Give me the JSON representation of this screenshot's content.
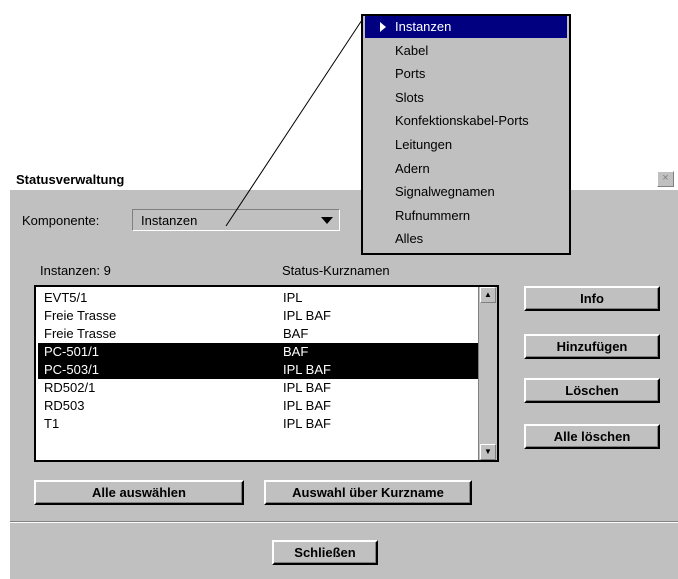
{
  "dialog": {
    "title": "Statusverwaltung",
    "close_label": "×",
    "komponente_label": "Komponente:",
    "combo_value": "Instanzen"
  },
  "list": {
    "header_left": "Instanzen: 9",
    "header_right": "Status-Kurznamen",
    "rows": [
      {
        "name": "EVT5/1",
        "status": "IPL",
        "selected": false
      },
      {
        "name": "Freie Trasse",
        "status": "IPL BAF",
        "selected": false
      },
      {
        "name": "Freie Trasse",
        "status": "BAF",
        "selected": false
      },
      {
        "name": "PC-501/1",
        "status": "BAF",
        "selected": true
      },
      {
        "name": "PC-503/1",
        "status": "IPL BAF",
        "selected": true
      },
      {
        "name": "RD502/1",
        "status": "IPL BAF",
        "selected": false
      },
      {
        "name": "RD503",
        "status": "IPL BAF",
        "selected": false
      },
      {
        "name": "T1",
        "status": "IPL BAF",
        "selected": false
      }
    ]
  },
  "buttons": {
    "info": "Info",
    "add": "Hinzufügen",
    "delete": "Löschen",
    "delete_all": "Alle löschen",
    "select_all": "Alle auswählen",
    "select_by_shortname": "Auswahl über Kurzname",
    "close": "Schließen"
  },
  "dropdown_menu": {
    "items": [
      "Instanzen",
      "Kabel",
      "Ports",
      "Slots",
      "Konfektionskabel-Ports",
      "Leitungen",
      "Adern",
      "Signalwegnamen",
      "Rufnummern",
      "Alles"
    ],
    "selected_index": 0
  },
  "colors": {
    "dialog_bg": "#c0c0c0",
    "selection": "#000000",
    "menu_highlight": "#000080"
  }
}
